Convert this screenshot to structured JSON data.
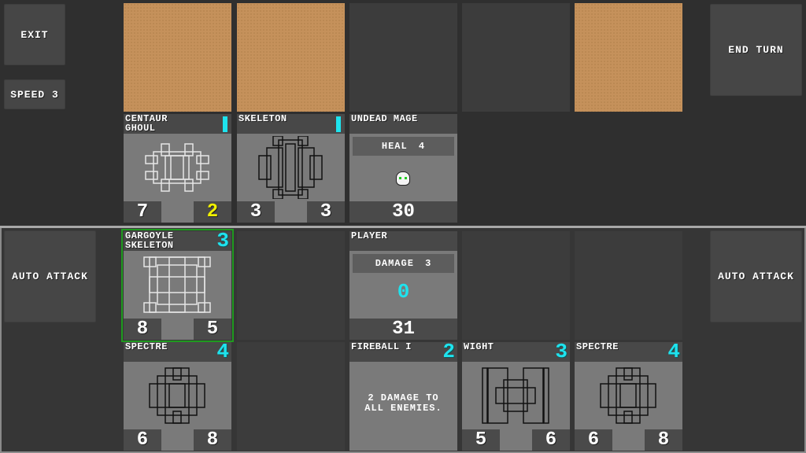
{
  "buttons": {
    "exit": "Exit",
    "speed": "Speed 3",
    "end_turn": "End Turn",
    "auto_attack_left": "Auto Attack",
    "auto_attack_right": "Auto Attack"
  },
  "colors": {
    "cost": "#1ee3ee",
    "buffed_stat": "#f0f000",
    "selected": "#1f9a1f",
    "board_enemy": "#c5915b"
  },
  "enemy_board": [
    "sand",
    "sand",
    "empty",
    "empty",
    "sand"
  ],
  "enemy_row": [
    {
      "type": "creature",
      "name": "Centaur\nGhoul",
      "cost": "1",
      "cost_style": "bar",
      "attack": "7",
      "health": "2",
      "health_color": "yellow",
      "sprite": "white-golem"
    },
    {
      "type": "creature",
      "name": "Skeleton",
      "cost": "1",
      "cost_style": "bar",
      "attack": "3",
      "health": "3",
      "sprite": "black-skeleton"
    },
    {
      "type": "hero",
      "name": "Undead Mage",
      "ability": "Heal 4",
      "icon": "skull-icon",
      "health": "30"
    }
  ],
  "player_board": [
    {
      "type": "creature",
      "name": "Gargoyle\nSkeleton",
      "cost": "3",
      "attack": "8",
      "health": "5",
      "sprite": "white-gargoyle",
      "selected": true
    },
    {
      "type": "empty"
    },
    {
      "type": "hero",
      "name": "Player",
      "ability": "Damage 3",
      "value": "0",
      "health": "31"
    },
    {
      "type": "empty"
    },
    {
      "type": "empty"
    }
  ],
  "hand": [
    {
      "type": "creature",
      "name": "Spectre",
      "cost": "4",
      "attack": "6",
      "health": "8",
      "sprite": "black-spectre"
    },
    {
      "type": "empty"
    },
    {
      "type": "spell",
      "name": "Fireball I",
      "cost": "2",
      "description": "2 damage to\nall enemies."
    },
    {
      "type": "creature",
      "name": "Wight",
      "cost": "3",
      "attack": "5",
      "health": "6",
      "sprite": "black-wight"
    },
    {
      "type": "creature",
      "name": "Spectre",
      "cost": "4",
      "attack": "6",
      "health": "8",
      "sprite": "black-spectre"
    }
  ]
}
